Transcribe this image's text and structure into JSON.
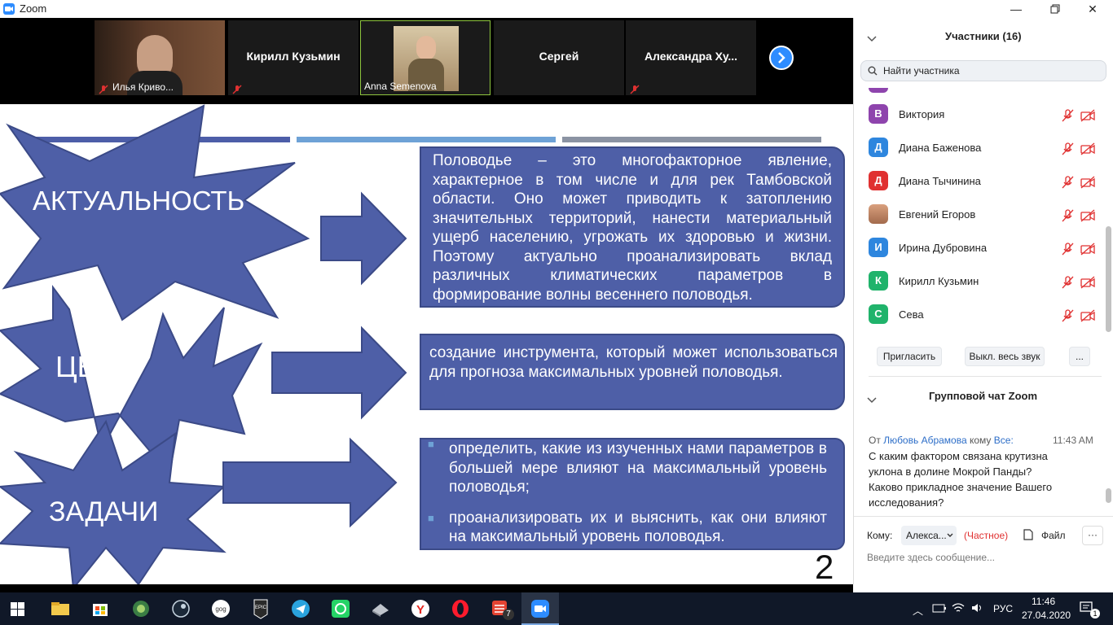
{
  "window": {
    "title": "Zoom"
  },
  "video_strip": {
    "tiles": [
      {
        "name": "Илья Криво...",
        "caption": "Илья Криво..."
      },
      {
        "name": "Кирилл Кузьмин"
      },
      {
        "name": "Anna Semenova",
        "caption": "Anna Semenova"
      },
      {
        "name": "Сергей"
      },
      {
        "name": "Александра  Ху..."
      }
    ]
  },
  "slide": {
    "labels": {
      "relevance": "АКТУАЛЬНОСТЬ",
      "goal": "ЦЕЛЬ",
      "tasks": "ЗАДАЧИ"
    },
    "relevance_text": "Половодье – это многофакторное явление, характерное в том числе и для рек Тамбовской области. Оно может приводить к затоплению значительных территорий, нанести материальный ущерб населению, угрожать их здоровью и жизни. Поэтому актуально проанализировать вклад различных климатических параметров в формирование волны весеннего половодья.",
    "goal_text": "создание инструмента, который может использоваться для прогноза максимальных уровней половодья.",
    "tasks": [
      "определить, какие из изученных нами параметров в большей мере влияют на максимальный уровень половодья;",
      "проанализировать их и выяснить, как они влияют на максимальный уровень половодья."
    ],
    "page_number": "2"
  },
  "participants": {
    "header": "Участники (16)",
    "search_placeholder": "Найти участника",
    "items": [
      {
        "initial": "В",
        "name": "Виктория",
        "color": "#8e44ad"
      },
      {
        "initial": "Д",
        "name": "Диана Баженова",
        "color": "#2e86de"
      },
      {
        "initial": "Д",
        "name": "Диана Тычинина",
        "color": "#e03131"
      },
      {
        "initial": "",
        "name": "Евгений Егоров",
        "color": "#c98b6b"
      },
      {
        "initial": "И",
        "name": "Ирина Дубровина",
        "color": "#2e86de"
      },
      {
        "initial": "К",
        "name": "Кирилл Кузьмин",
        "color": "#20b36b"
      },
      {
        "initial": "С",
        "name": "Сева",
        "color": "#20b36b"
      }
    ],
    "buttons": {
      "invite": "Пригласить",
      "mute_all": "Выкл. весь звук",
      "more": "..."
    }
  },
  "chat": {
    "header": "Групповой чат Zoom",
    "message": {
      "from_prefix": "От",
      "sender": "Любовь Абрамова",
      "to_prefix": "кому",
      "recipient": "Все:",
      "time": "11:43 AM",
      "lines": [
        "С каким фактором связана крутизна",
        "уклона в долине  Мокрой Панды?",
        "Каково прикладное значение Вашего",
        "исследования?"
      ]
    },
    "to_label": "Кому:",
    "to_value": "Алекса...",
    "private": "(Частное)",
    "file": "Файл",
    "more": "···",
    "input_placeholder": "Введите здесь сообщение..."
  },
  "taskbar": {
    "lang": "РУС",
    "time": "11:46",
    "date": "27.04.2020",
    "badge": "7",
    "notif_count": "1"
  },
  "colors": {
    "slide_box": "#4e5fa7",
    "zoom_blue": "#2d8cff",
    "private_red": "#e03131"
  }
}
